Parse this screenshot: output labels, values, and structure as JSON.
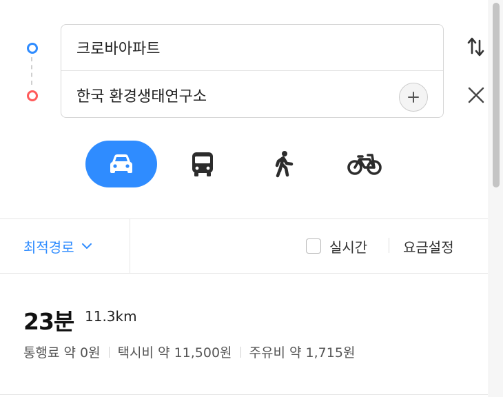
{
  "search": {
    "origin": "크로바아파트",
    "destination": "한국 환경생태연구소"
  },
  "icons": {
    "swap": "swap-vertical-icon",
    "close": "close-icon",
    "add": "plus-icon",
    "car": "car-icon",
    "bus": "bus-icon",
    "walk": "walk-icon",
    "bike": "bicycle-icon"
  },
  "colors": {
    "accent": "#2f8cff",
    "origin_dot": "#2f8cff",
    "destination_dot": "#ff5b5b"
  },
  "options": {
    "route_type": "최적경로",
    "realtime_label": "실시간",
    "realtime_checked": false,
    "fare_settings": "요금설정"
  },
  "route": {
    "time": "23분",
    "distance": "11.3km",
    "toll": "통행료 약 0원",
    "taxi": "택시비 약 11,500원",
    "fuel": "주유비 약 1,715원"
  }
}
